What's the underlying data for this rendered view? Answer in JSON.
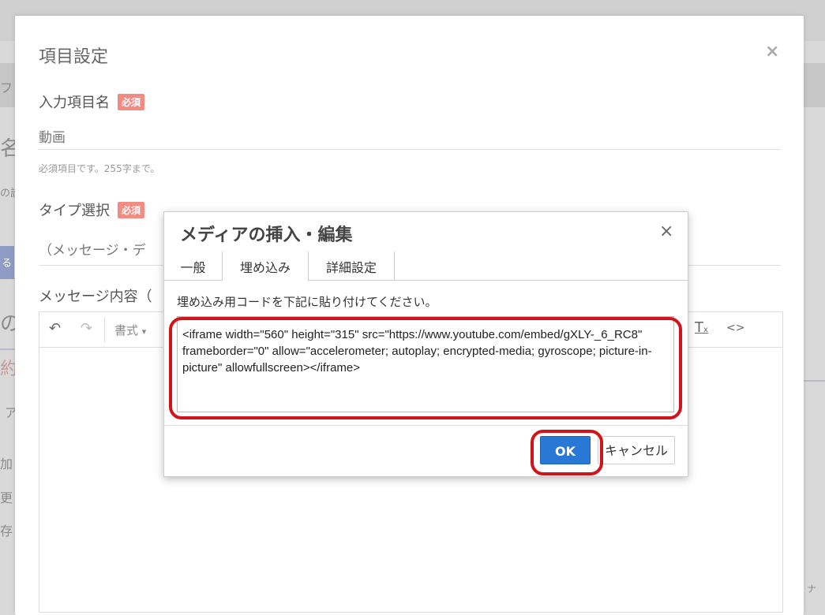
{
  "colors": {
    "overlay": "#d9d9d9",
    "required_badge": "#f28b82",
    "ok_button": "#2a78d6",
    "highlight": "#d0141a"
  },
  "background": {
    "fragments": [
      "フ",
      "名",
      "の設",
      "る",
      "の",
      "約の",
      "ア",
      "加",
      "更",
      "存",
      "ナ"
    ]
  },
  "modal": {
    "title": "項目設定",
    "close_icon": "×",
    "field_name": {
      "label": "入力項目名",
      "badge": "必須",
      "value": "動画",
      "help": "必須項目です。255字まで。"
    },
    "field_type": {
      "label": "タイプ選択",
      "badge": "必須",
      "value": "（メッセージ・デ"
    },
    "field_message": {
      "label": "メッセージ内容（"
    },
    "editor": {
      "undo_icon": "↶",
      "redo_icon": "↷",
      "format_label": "書式",
      "format_caret": "▾",
      "clear_format_icon": "T",
      "clear_format_sub": "x",
      "code_icon": "<>"
    }
  },
  "dialog": {
    "title": "メディアの挿入・編集",
    "close_icon": "×",
    "tabs": [
      {
        "label": "一般"
      },
      {
        "label": "埋め込み"
      },
      {
        "label": "詳細設定"
      }
    ],
    "instruction": "埋め込み用コードを下記に貼り付けてください。",
    "embed_code": "<iframe width=\"560\" height=\"315\" src=\"https://www.youtube.com/embed/gXLY-_6_RC8\" frameborder=\"0\" allow=\"accelerometer; autoplay; encrypted-media; gyroscope; picture-in-picture\" allowfullscreen></iframe>",
    "ok_label": "OK",
    "cancel_label": "キャンセル"
  }
}
